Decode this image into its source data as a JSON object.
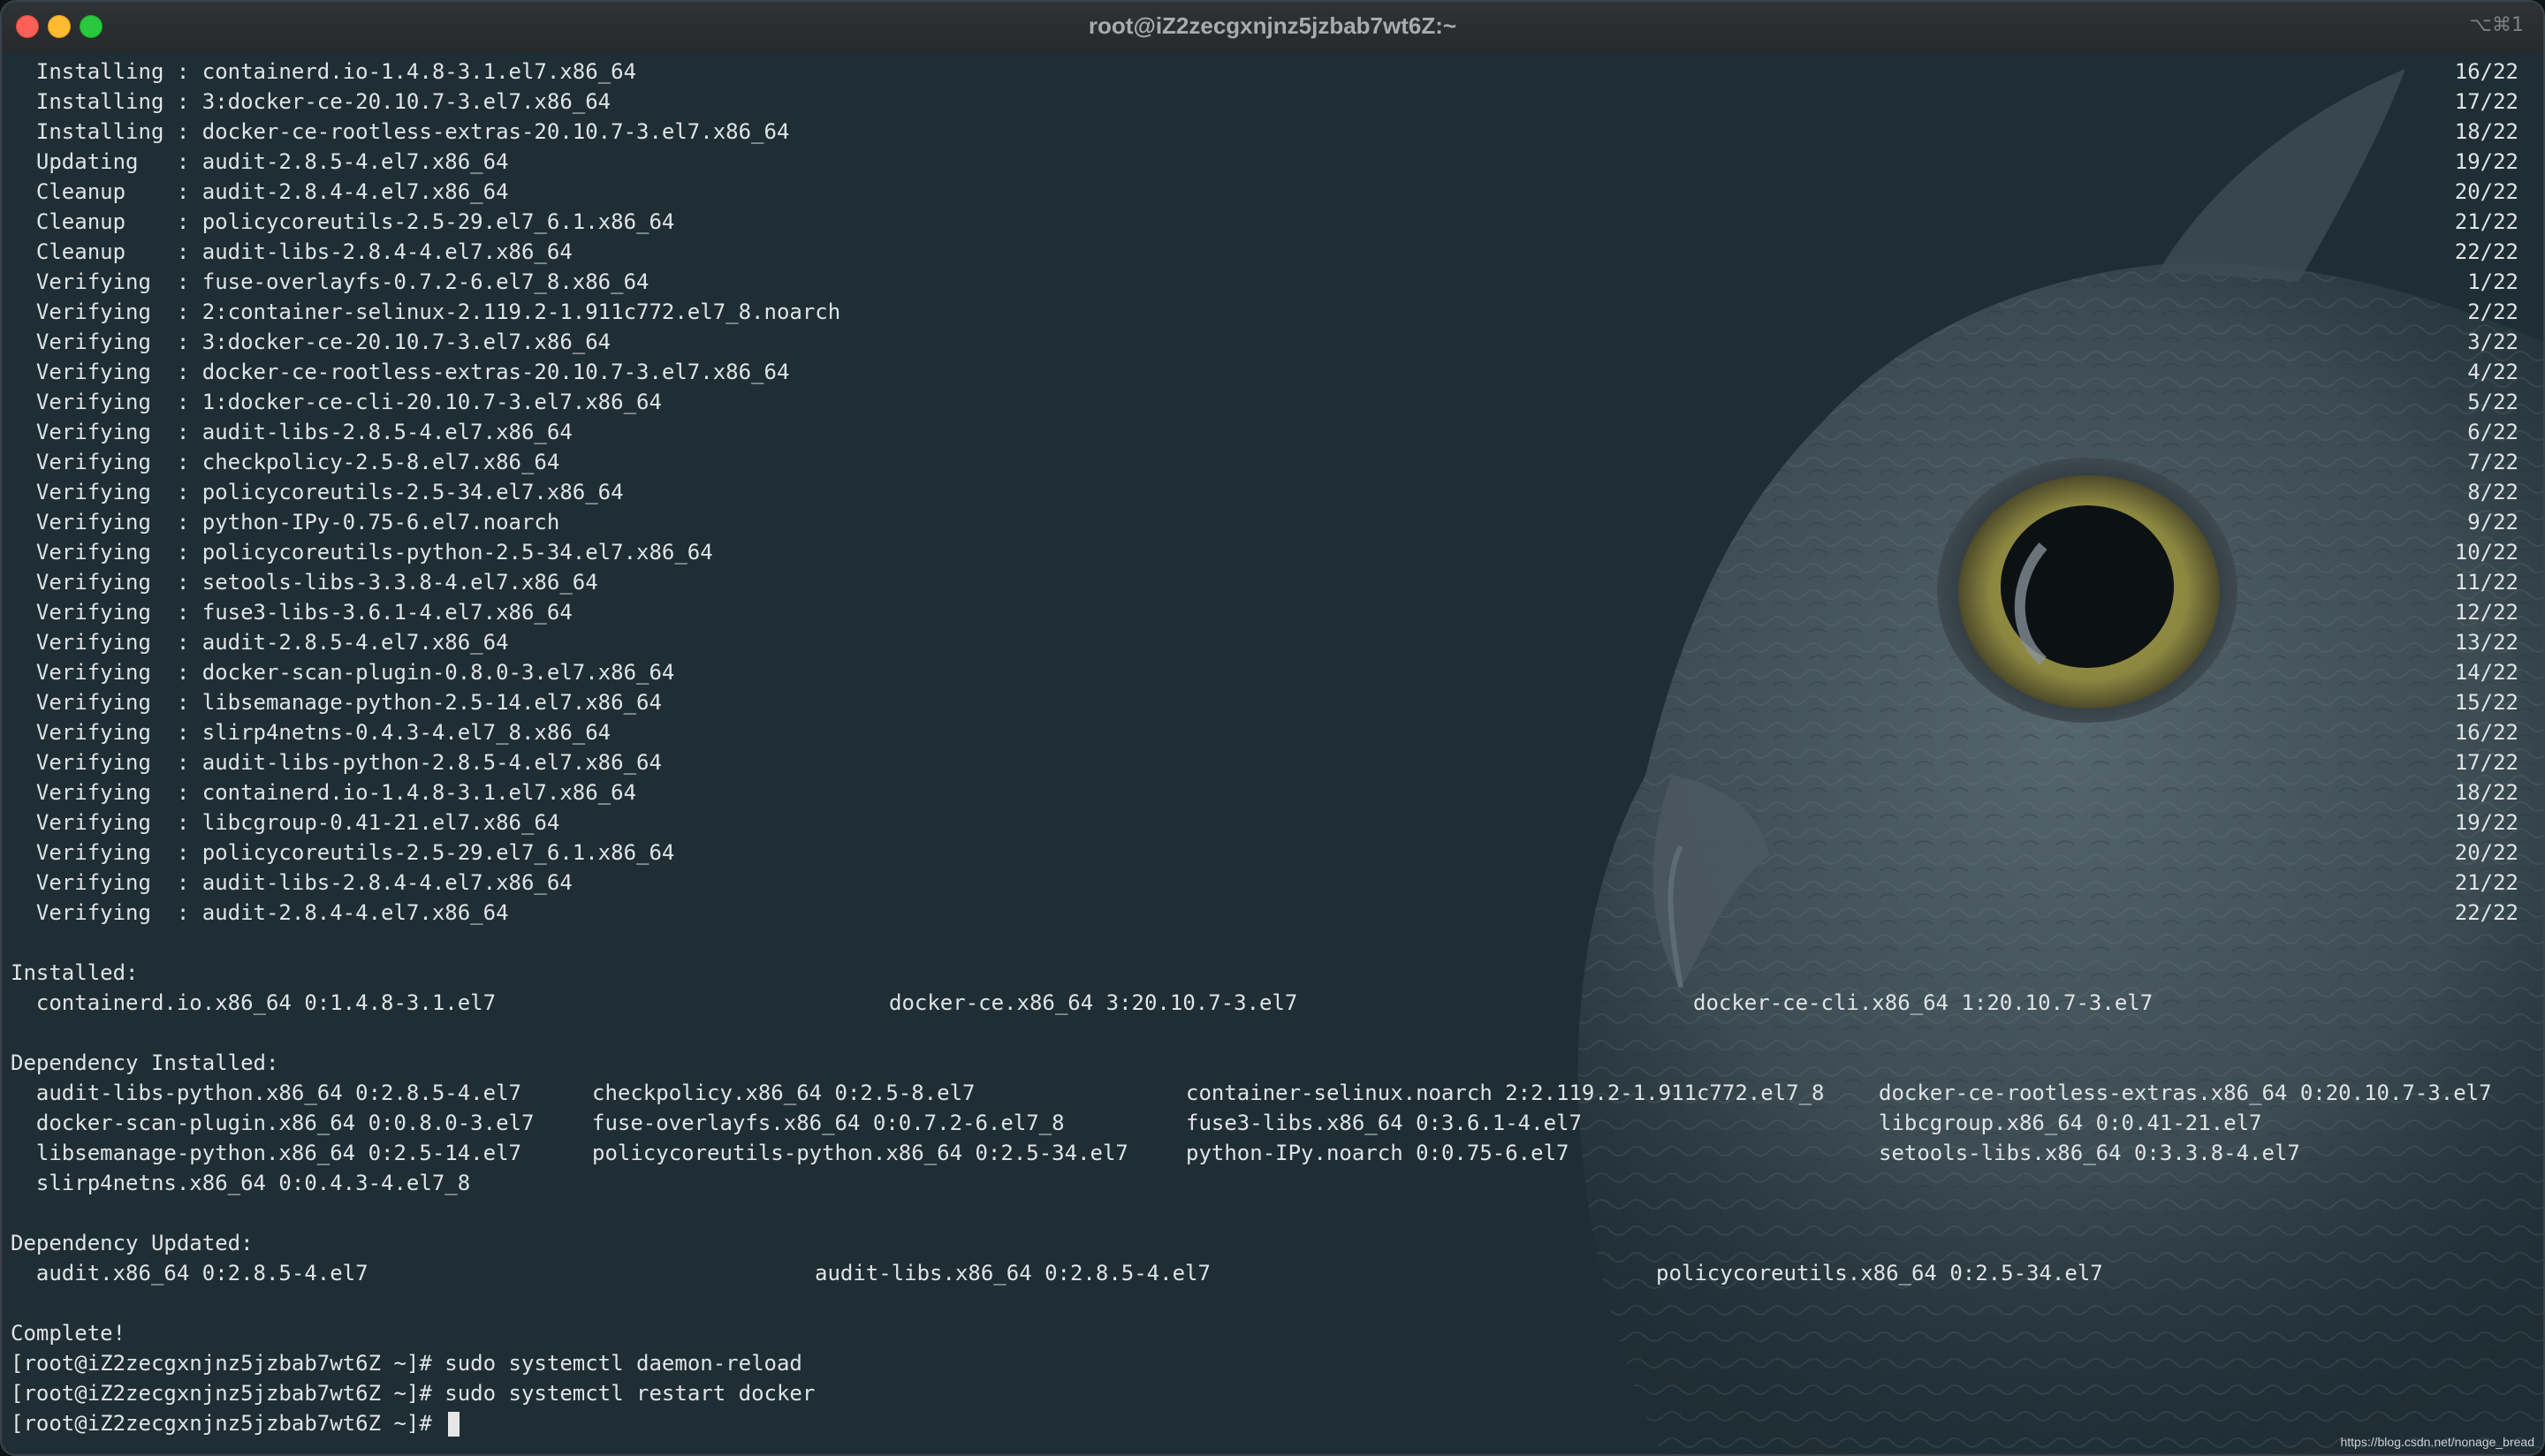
{
  "window": {
    "title": "root@iZ2zecgxnjnz5jzbab7wt6Z:~",
    "shortcut": "⌥⌘1"
  },
  "colors": {
    "background": "#1f2d34",
    "text": "#dfe4e6",
    "close": "#fe5f57",
    "minimize": "#febc2e",
    "maximize": "#28c840"
  },
  "transactions": [
    {
      "text": "  Installing : containerd.io-1.4.8-3.1.el7.x86_64",
      "progress": "16/22"
    },
    {
      "text": "  Installing : 3:docker-ce-20.10.7-3.el7.x86_64",
      "progress": "17/22"
    },
    {
      "text": "  Installing : docker-ce-rootless-extras-20.10.7-3.el7.x86_64",
      "progress": "18/22"
    },
    {
      "text": "  Updating   : audit-2.8.5-4.el7.x86_64",
      "progress": "19/22"
    },
    {
      "text": "  Cleanup    : audit-2.8.4-4.el7.x86_64",
      "progress": "20/22"
    },
    {
      "text": "  Cleanup    : policycoreutils-2.5-29.el7_6.1.x86_64",
      "progress": "21/22"
    },
    {
      "text": "  Cleanup    : audit-libs-2.8.4-4.el7.x86_64",
      "progress": "22/22"
    },
    {
      "text": "  Verifying  : fuse-overlayfs-0.7.2-6.el7_8.x86_64",
      "progress": "1/22"
    },
    {
      "text": "  Verifying  : 2:container-selinux-2.119.2-1.911c772.el7_8.noarch",
      "progress": "2/22"
    },
    {
      "text": "  Verifying  : 3:docker-ce-20.10.7-3.el7.x86_64",
      "progress": "3/22"
    },
    {
      "text": "  Verifying  : docker-ce-rootless-extras-20.10.7-3.el7.x86_64",
      "progress": "4/22"
    },
    {
      "text": "  Verifying  : 1:docker-ce-cli-20.10.7-3.el7.x86_64",
      "progress": "5/22"
    },
    {
      "text": "  Verifying  : audit-libs-2.8.5-4.el7.x86_64",
      "progress": "6/22"
    },
    {
      "text": "  Verifying  : checkpolicy-2.5-8.el7.x86_64",
      "progress": "7/22"
    },
    {
      "text": "  Verifying  : policycoreutils-2.5-34.el7.x86_64",
      "progress": "8/22"
    },
    {
      "text": "  Verifying  : python-IPy-0.75-6.el7.noarch",
      "progress": "9/22"
    },
    {
      "text": "  Verifying  : policycoreutils-python-2.5-34.el7.x86_64",
      "progress": "10/22"
    },
    {
      "text": "  Verifying  : setools-libs-3.3.8-4.el7.x86_64",
      "progress": "11/22"
    },
    {
      "text": "  Verifying  : fuse3-libs-3.6.1-4.el7.x86_64",
      "progress": "12/22"
    },
    {
      "text": "  Verifying  : audit-2.8.5-4.el7.x86_64",
      "progress": "13/22"
    },
    {
      "text": "  Verifying  : docker-scan-plugin-0.8.0-3.el7.x86_64",
      "progress": "14/22"
    },
    {
      "text": "  Verifying  : libsemanage-python-2.5-14.el7.x86_64",
      "progress": "15/22"
    },
    {
      "text": "  Verifying  : slirp4netns-0.4.3-4.el7_8.x86_64",
      "progress": "16/22"
    },
    {
      "text": "  Verifying  : audit-libs-python-2.8.5-4.el7.x86_64",
      "progress": "17/22"
    },
    {
      "text": "  Verifying  : containerd.io-1.4.8-3.1.el7.x86_64",
      "progress": "18/22"
    },
    {
      "text": "  Verifying  : libcgroup-0.41-21.el7.x86_64",
      "progress": "19/22"
    },
    {
      "text": "  Verifying  : policycoreutils-2.5-29.el7_6.1.x86_64",
      "progress": "20/22"
    },
    {
      "text": "  Verifying  : audit-libs-2.8.4-4.el7.x86_64",
      "progress": "21/22"
    },
    {
      "text": "  Verifying  : audit-2.8.4-4.el7.x86_64",
      "progress": "22/22"
    }
  ],
  "installed": {
    "header": "Installed:",
    "row": [
      "  containerd.io.x86_64 0:1.4.8-3.1.el7",
      "docker-ce.x86_64 3:20.10.7-3.el7",
      "docker-ce-cli.x86_64 1:20.10.7-3.el7"
    ]
  },
  "dependency_installed": {
    "header": "Dependency Installed:",
    "rows": [
      [
        "  audit-libs-python.x86_64 0:2.8.5-4.el7",
        "checkpolicy.x86_64 0:2.5-8.el7",
        "container-selinux.noarch 2:2.119.2-1.911c772.el7_8",
        "docker-ce-rootless-extras.x86_64 0:20.10.7-3.el7"
      ],
      [
        "  docker-scan-plugin.x86_64 0:0.8.0-3.el7",
        "fuse-overlayfs.x86_64 0:0.7.2-6.el7_8",
        "fuse3-libs.x86_64 0:3.6.1-4.el7",
        "libcgroup.x86_64 0:0.41-21.el7"
      ],
      [
        "  libsemanage-python.x86_64 0:2.5-14.el7",
        "policycoreutils-python.x86_64 0:2.5-34.el7",
        "python-IPy.noarch 0:0.75-6.el7",
        "setools-libs.x86_64 0:3.3.8-4.el7"
      ],
      [
        "  slirp4netns.x86_64 0:0.4.3-4.el7_8",
        "",
        "",
        ""
      ]
    ]
  },
  "dependency_updated": {
    "header": "Dependency Updated:",
    "row": [
      "  audit.x86_64 0:2.8.5-4.el7",
      "audit-libs.x86_64 0:2.8.5-4.el7",
      "policycoreutils.x86_64 0:2.5-34.el7"
    ]
  },
  "complete": "Complete!",
  "prompt": "[root@iZ2zecgxnjnz5jzbab7wt6Z ~]# ",
  "commands": [
    "sudo systemctl daemon-reload",
    "sudo systemctl restart docker"
  ],
  "watermark": "https://blog.csdn.net/nonage_bread"
}
